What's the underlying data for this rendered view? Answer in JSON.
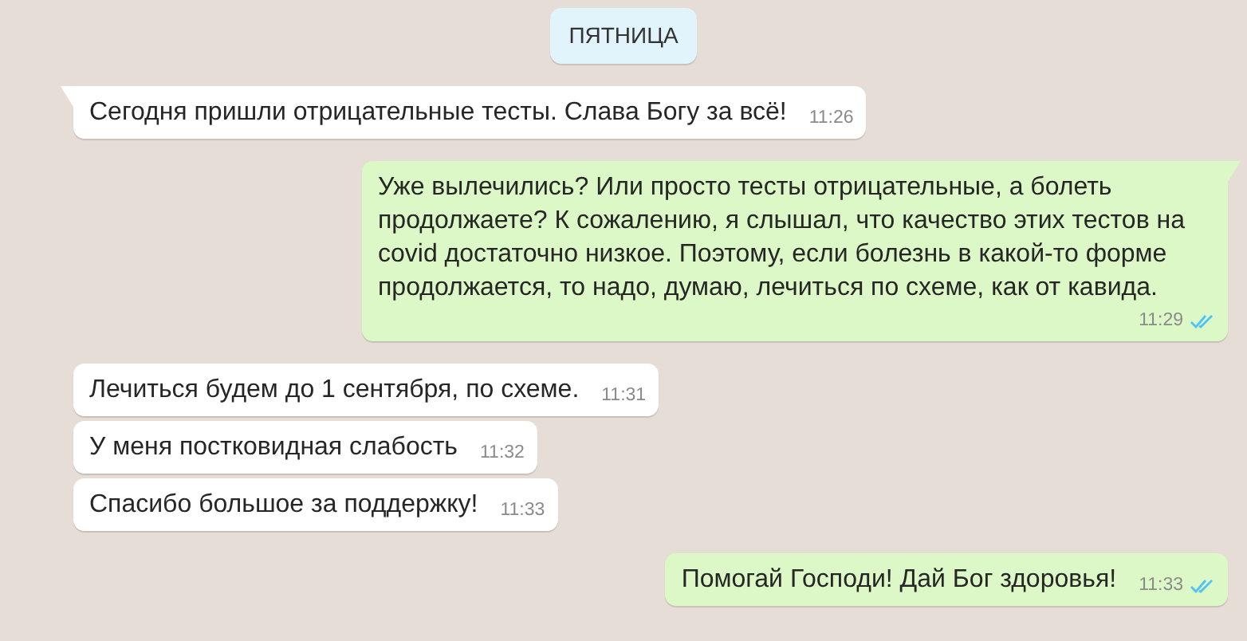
{
  "date_badge": "ПЯТНИЦА",
  "messages": [
    {
      "kind": "incoming",
      "text": "Сегодня пришли отрицательные тесты. Слава Богу за всё!",
      "time": "11:26",
      "tail": true
    },
    {
      "kind": "outgoing",
      "text": "Уже вылечились? Или просто тесты отрицательные, а болеть продолжаете? К сожалению, я слышал, что качество этих тестов на covid достаточно низкое. Поэтому, если болезнь в какой-то форме продолжается, то надо, думаю, лечиться по схеме, как от кавида.",
      "time": "11:29",
      "tail": true,
      "read": true
    },
    {
      "kind": "incoming",
      "text": "Лечиться будем до 1 сентября, по схеме.",
      "time": "11:31",
      "tail": false
    },
    {
      "kind": "incoming",
      "text": "У меня постковидная слабость",
      "time": "11:32",
      "tail": false
    },
    {
      "kind": "incoming",
      "text": "Спасибо большое за поддержку!",
      "time": "11:33",
      "tail": false
    },
    {
      "kind": "outgoing",
      "text": "Помогай Господи! Дай Бог здоровья!",
      "time": "11:33",
      "tail": false,
      "read": true
    }
  ]
}
